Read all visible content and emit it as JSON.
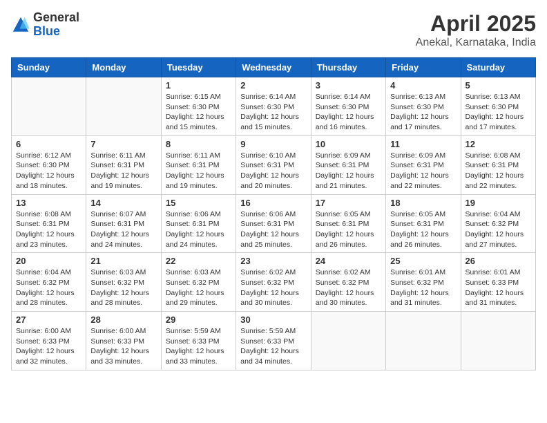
{
  "logo": {
    "general": "General",
    "blue": "Blue"
  },
  "title": "April 2025",
  "subtitle": "Anekal, Karnataka, India",
  "weekdays": [
    "Sunday",
    "Monday",
    "Tuesday",
    "Wednesday",
    "Thursday",
    "Friday",
    "Saturday"
  ],
  "weeks": [
    [
      {
        "day": "",
        "info": ""
      },
      {
        "day": "",
        "info": ""
      },
      {
        "day": "1",
        "info": "Sunrise: 6:15 AM\nSunset: 6:30 PM\nDaylight: 12 hours and 15 minutes."
      },
      {
        "day": "2",
        "info": "Sunrise: 6:14 AM\nSunset: 6:30 PM\nDaylight: 12 hours and 15 minutes."
      },
      {
        "day": "3",
        "info": "Sunrise: 6:14 AM\nSunset: 6:30 PM\nDaylight: 12 hours and 16 minutes."
      },
      {
        "day": "4",
        "info": "Sunrise: 6:13 AM\nSunset: 6:30 PM\nDaylight: 12 hours and 17 minutes."
      },
      {
        "day": "5",
        "info": "Sunrise: 6:13 AM\nSunset: 6:30 PM\nDaylight: 12 hours and 17 minutes."
      }
    ],
    [
      {
        "day": "6",
        "info": "Sunrise: 6:12 AM\nSunset: 6:30 PM\nDaylight: 12 hours and 18 minutes."
      },
      {
        "day": "7",
        "info": "Sunrise: 6:11 AM\nSunset: 6:31 PM\nDaylight: 12 hours and 19 minutes."
      },
      {
        "day": "8",
        "info": "Sunrise: 6:11 AM\nSunset: 6:31 PM\nDaylight: 12 hours and 19 minutes."
      },
      {
        "day": "9",
        "info": "Sunrise: 6:10 AM\nSunset: 6:31 PM\nDaylight: 12 hours and 20 minutes."
      },
      {
        "day": "10",
        "info": "Sunrise: 6:09 AM\nSunset: 6:31 PM\nDaylight: 12 hours and 21 minutes."
      },
      {
        "day": "11",
        "info": "Sunrise: 6:09 AM\nSunset: 6:31 PM\nDaylight: 12 hours and 22 minutes."
      },
      {
        "day": "12",
        "info": "Sunrise: 6:08 AM\nSunset: 6:31 PM\nDaylight: 12 hours and 22 minutes."
      }
    ],
    [
      {
        "day": "13",
        "info": "Sunrise: 6:08 AM\nSunset: 6:31 PM\nDaylight: 12 hours and 23 minutes."
      },
      {
        "day": "14",
        "info": "Sunrise: 6:07 AM\nSunset: 6:31 PM\nDaylight: 12 hours and 24 minutes."
      },
      {
        "day": "15",
        "info": "Sunrise: 6:06 AM\nSunset: 6:31 PM\nDaylight: 12 hours and 24 minutes."
      },
      {
        "day": "16",
        "info": "Sunrise: 6:06 AM\nSunset: 6:31 PM\nDaylight: 12 hours and 25 minutes."
      },
      {
        "day": "17",
        "info": "Sunrise: 6:05 AM\nSunset: 6:31 PM\nDaylight: 12 hours and 26 minutes."
      },
      {
        "day": "18",
        "info": "Sunrise: 6:05 AM\nSunset: 6:31 PM\nDaylight: 12 hours and 26 minutes."
      },
      {
        "day": "19",
        "info": "Sunrise: 6:04 AM\nSunset: 6:32 PM\nDaylight: 12 hours and 27 minutes."
      }
    ],
    [
      {
        "day": "20",
        "info": "Sunrise: 6:04 AM\nSunset: 6:32 PM\nDaylight: 12 hours and 28 minutes."
      },
      {
        "day": "21",
        "info": "Sunrise: 6:03 AM\nSunset: 6:32 PM\nDaylight: 12 hours and 28 minutes."
      },
      {
        "day": "22",
        "info": "Sunrise: 6:03 AM\nSunset: 6:32 PM\nDaylight: 12 hours and 29 minutes."
      },
      {
        "day": "23",
        "info": "Sunrise: 6:02 AM\nSunset: 6:32 PM\nDaylight: 12 hours and 30 minutes."
      },
      {
        "day": "24",
        "info": "Sunrise: 6:02 AM\nSunset: 6:32 PM\nDaylight: 12 hours and 30 minutes."
      },
      {
        "day": "25",
        "info": "Sunrise: 6:01 AM\nSunset: 6:32 PM\nDaylight: 12 hours and 31 minutes."
      },
      {
        "day": "26",
        "info": "Sunrise: 6:01 AM\nSunset: 6:33 PM\nDaylight: 12 hours and 31 minutes."
      }
    ],
    [
      {
        "day": "27",
        "info": "Sunrise: 6:00 AM\nSunset: 6:33 PM\nDaylight: 12 hours and 32 minutes."
      },
      {
        "day": "28",
        "info": "Sunrise: 6:00 AM\nSunset: 6:33 PM\nDaylight: 12 hours and 33 minutes."
      },
      {
        "day": "29",
        "info": "Sunrise: 5:59 AM\nSunset: 6:33 PM\nDaylight: 12 hours and 33 minutes."
      },
      {
        "day": "30",
        "info": "Sunrise: 5:59 AM\nSunset: 6:33 PM\nDaylight: 12 hours and 34 minutes."
      },
      {
        "day": "",
        "info": ""
      },
      {
        "day": "",
        "info": ""
      },
      {
        "day": "",
        "info": ""
      }
    ]
  ]
}
